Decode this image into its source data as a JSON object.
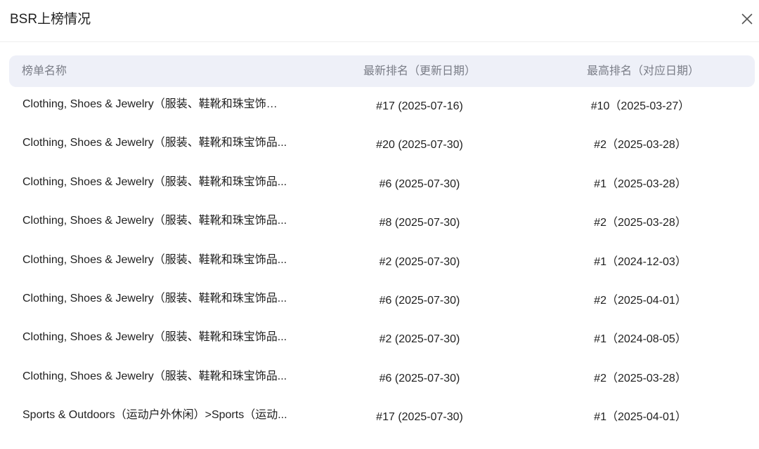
{
  "modal": {
    "title": "BSR上榜情况"
  },
  "table": {
    "headers": {
      "name": "榜单名称",
      "latest": "最新排名（更新日期）",
      "highest": "最高排名（对应日期）"
    },
    "rows": [
      {
        "name": "Clothing, Shoes & Jewelry（服装、鞋靴和珠宝饰品）",
        "latest": "#17 (2025-07-16)",
        "highest": "#10（2025-03-27）"
      },
      {
        "name": "Clothing, Shoes & Jewelry（服装、鞋靴和珠宝饰品...",
        "latest": "#20 (2025-07-30)",
        "highest": "#2（2025-03-28）"
      },
      {
        "name": "Clothing, Shoes & Jewelry（服装、鞋靴和珠宝饰品...",
        "latest": "#6 (2025-07-30)",
        "highest": "#1（2025-03-28）"
      },
      {
        "name": "Clothing, Shoes & Jewelry（服装、鞋靴和珠宝饰品...",
        "latest": "#8 (2025-07-30)",
        "highest": "#2（2025-03-28）"
      },
      {
        "name": "Clothing, Shoes & Jewelry（服装、鞋靴和珠宝饰品...",
        "latest": "#2 (2025-07-30)",
        "highest": "#1（2024-12-03）"
      },
      {
        "name": "Clothing, Shoes & Jewelry（服装、鞋靴和珠宝饰品...",
        "latest": "#6 (2025-07-30)",
        "highest": "#2（2025-04-01）"
      },
      {
        "name": "Clothing, Shoes & Jewelry（服装、鞋靴和珠宝饰品...",
        "latest": "#2 (2025-07-30)",
        "highest": "#1（2024-08-05）"
      },
      {
        "name": "Clothing, Shoes & Jewelry（服装、鞋靴和珠宝饰品...",
        "latest": "#6 (2025-07-30)",
        "highest": "#2（2025-03-28）"
      },
      {
        "name": "Sports & Outdoors（运动户外休闲）>Sports（运动...",
        "latest": "#17 (2025-07-30)",
        "highest": "#1（2025-04-01）"
      }
    ]
  },
  "icons": {
    "close": "close-icon"
  }
}
